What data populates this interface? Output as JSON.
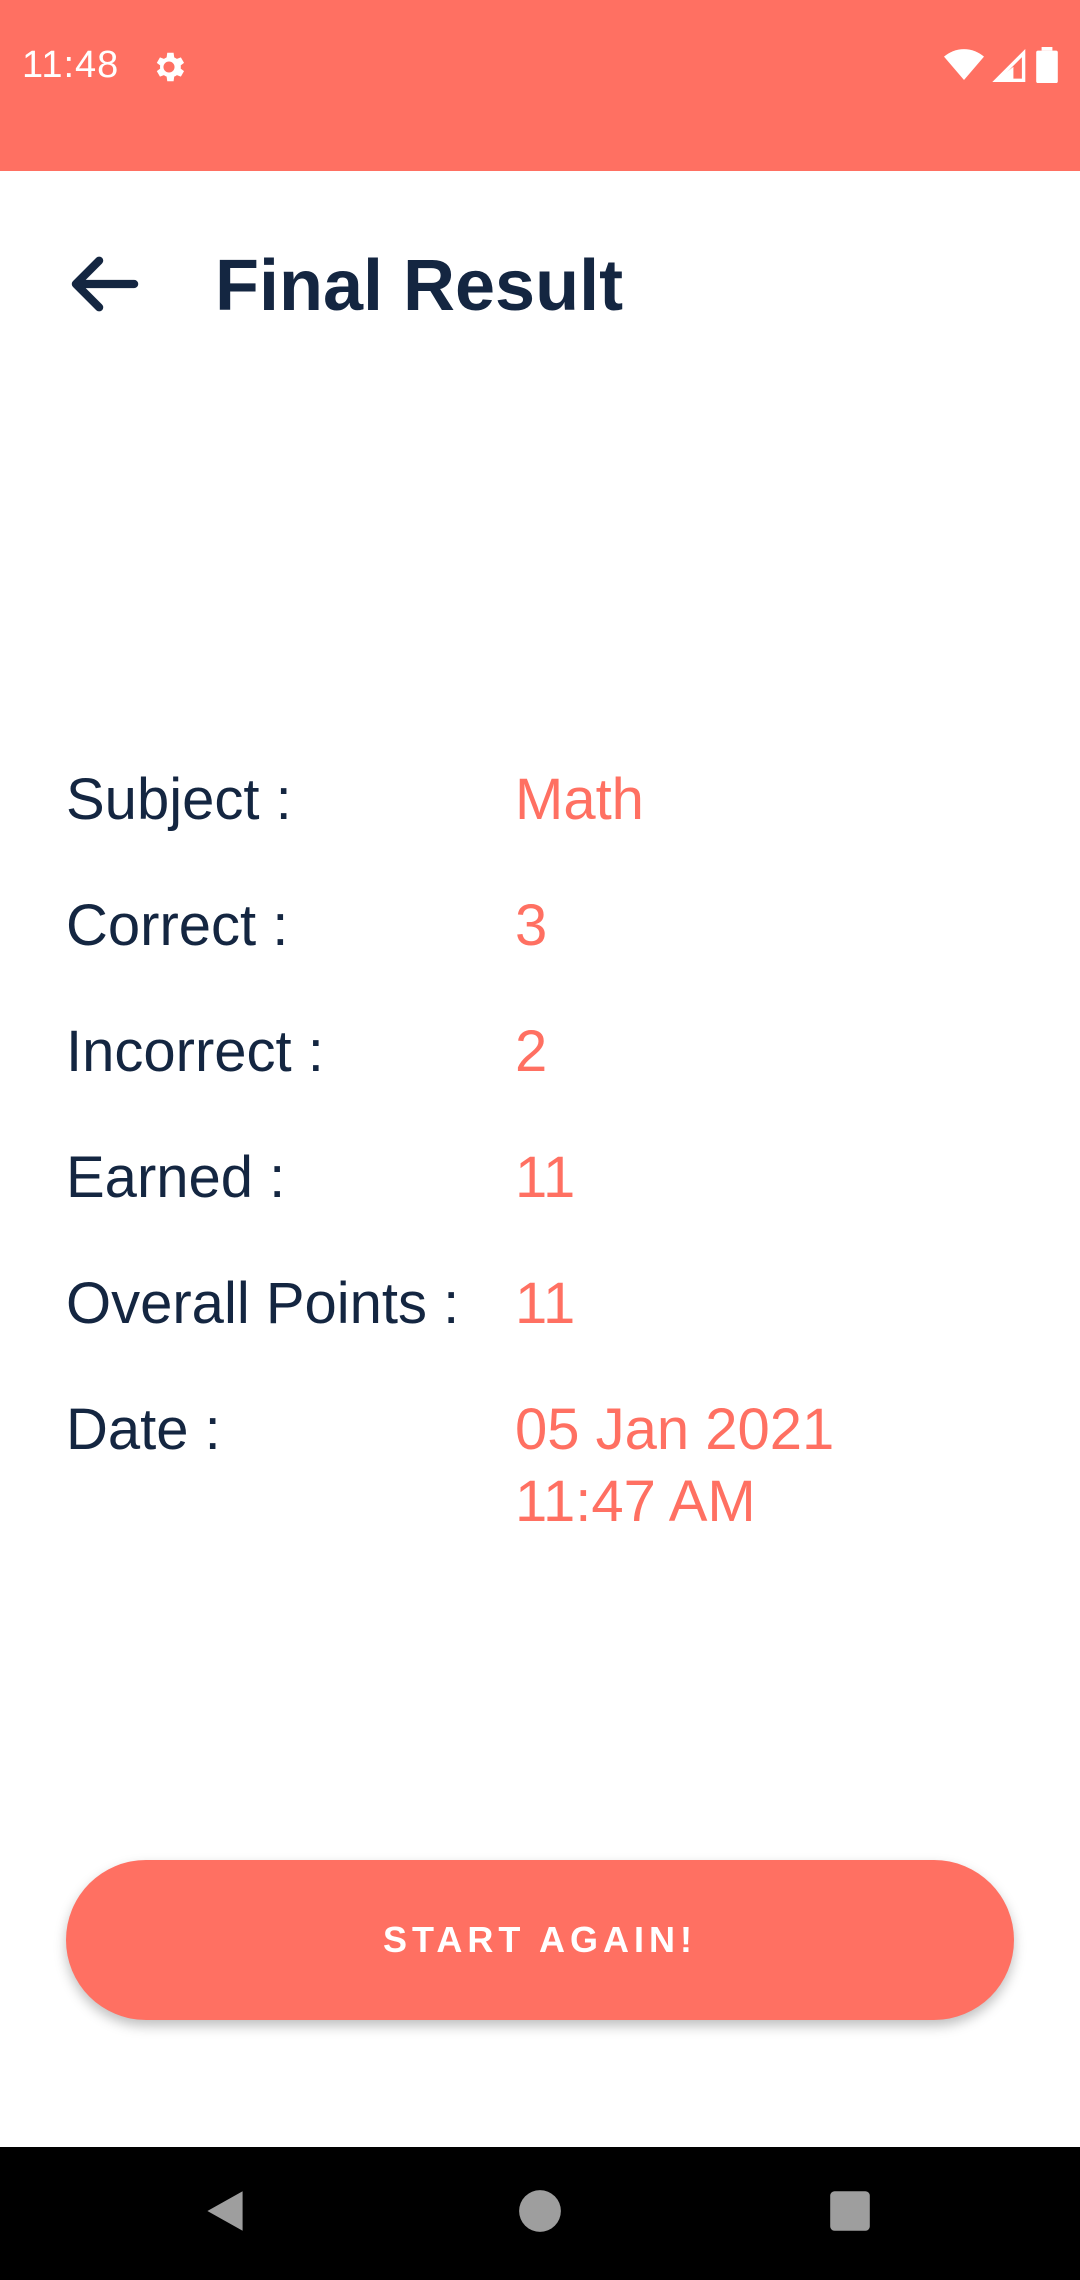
{
  "status_bar": {
    "time": "11:48",
    "icons": [
      "gear-icon",
      "wifi-icon",
      "signal-icon",
      "battery-icon"
    ],
    "background": "#FF7062"
  },
  "app_bar": {
    "title": "Final Result",
    "back_icon": "arrow-back-icon"
  },
  "results": [
    {
      "label": "Subject :",
      "value": "Math"
    },
    {
      "label": "Correct :",
      "value": "3"
    },
    {
      "label": "Incorrect :",
      "value": "2"
    },
    {
      "label": "Earned :",
      "value": "11"
    },
    {
      "label": "Overall Points :",
      "value": "11"
    },
    {
      "label": "Date :",
      "value_line1": "05 Jan 2021",
      "value_line2": "11:47 AM"
    }
  ],
  "actions": {
    "start_again": "START AGAIN!"
  },
  "nav_bar": {
    "icons": [
      "back-triangle-icon",
      "home-circle-icon",
      "recents-square-icon"
    ]
  },
  "colors": {
    "accent": "#FF7062",
    "text_dark": "#142641"
  }
}
